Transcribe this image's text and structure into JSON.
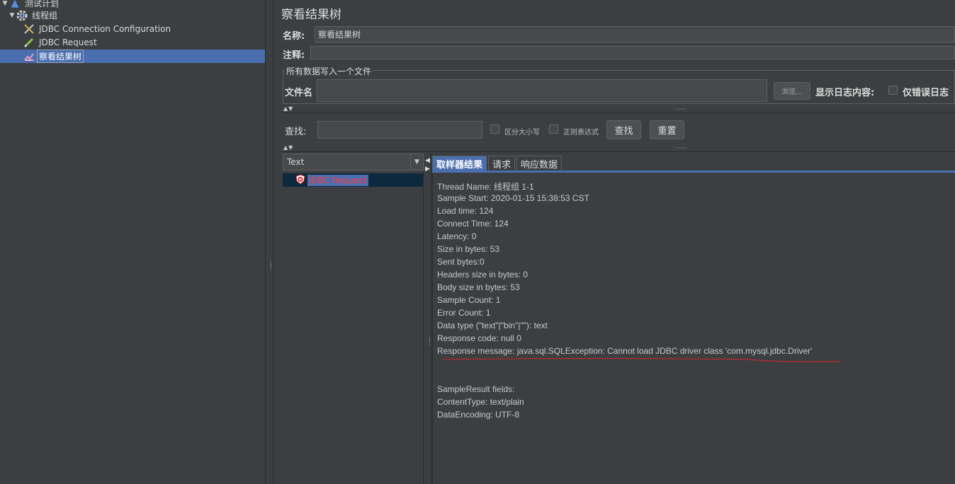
{
  "tree": {
    "items": [
      {
        "label": "测试计划",
        "icon": "test-plan-icon"
      },
      {
        "label": "线程组",
        "icon": "gear-icon"
      },
      {
        "label": "JDBC Connection Configuration",
        "icon": "wrench-icon"
      },
      {
        "label": "JDBC Request",
        "icon": "pen-icon"
      },
      {
        "label": "察看结果树",
        "icon": "chart-icon"
      }
    ]
  },
  "panel": {
    "title": "察看结果树",
    "name_label": "名称:",
    "name_value": "察看结果树",
    "comment_label": "注释:",
    "comment_value": "",
    "file_group_legend": "所有数据写入一个文件",
    "file_label": "文件名",
    "file_value": "",
    "browse_label": "浏览...",
    "log_display_label": "显示日志内容:",
    "errors_only_label": "仅错误日志",
    "search_label": "查找:",
    "search_value": "",
    "case_sensitive_label": "区分大小写",
    "regex_label": "正则表达式",
    "find_button": "查找",
    "reset_button": "重置"
  },
  "results": {
    "renderer": "Text",
    "items": [
      {
        "label": "JDBC Request",
        "status": "error"
      }
    ]
  },
  "detail": {
    "tabs": [
      "取样器结果",
      "请求",
      "响应数据"
    ],
    "active_tab": 0,
    "lines": [
      "Thread Name: 线程组 1-1",
      "Sample Start: 2020-01-15 15:38:53 CST",
      "Load time: 124",
      "Connect Time: 124",
      "Latency: 0",
      "Size in bytes: 53",
      "Sent bytes:0",
      "Headers size in bytes: 0",
      "Body size in bytes: 53",
      "Sample Count: 1",
      "Error Count: 1",
      "Data type (\"text\"|\"bin\"|\"\"): text",
      "Response code: null 0",
      "Response message: java.sql.SQLException: Cannot load JDBC driver class 'com.mysql.jdbc.Driver'"
    ],
    "fields_lines": [
      "SampleResult fields:",
      "ContentType: text/plain",
      "DataEncoding: UTF-8"
    ]
  },
  "colors": {
    "background": "#3c3f41",
    "selection": "#4b6eaf",
    "error_text": "#ff3b3b",
    "annotation_underline": "#c0282d"
  }
}
